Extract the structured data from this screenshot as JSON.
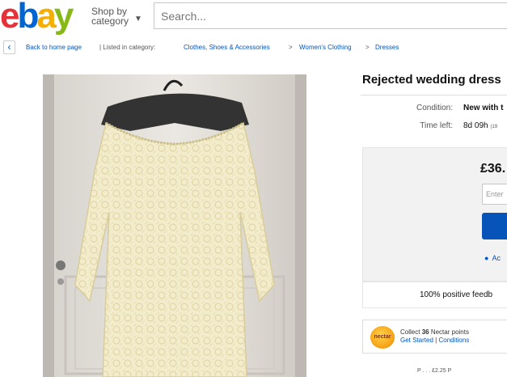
{
  "header": {
    "logo_text": "ebay",
    "shop_by_line1": "Shop by",
    "shop_by_line2": "category",
    "search_placeholder": "Search..."
  },
  "breadcrumb": {
    "back_label": "Back to home page",
    "listed_label": "| Listed in category:",
    "categories": [
      "Clothes, Shoes & Accessories",
      "Women's Clothing",
      "Dresses"
    ],
    "separator": ">"
  },
  "item": {
    "title": "Rejected wedding dress",
    "condition_label": "Condition:",
    "condition_value": "New with t",
    "time_left_label": "Time left:",
    "time_left_value": "8d 09h",
    "time_left_detail": "(19"
  },
  "bid": {
    "price": "£36.",
    "input_placeholder": "Enter",
    "watch_label": "Ac"
  },
  "seller": {
    "feedback": "100% positive feedb"
  },
  "nectar": {
    "logo_text": "nectar",
    "line1_prefix": "Collect",
    "points": "36",
    "line1_suffix": "Nectar points",
    "get_started": "Get Started",
    "divider": "|",
    "conditions": "Conditions"
  },
  "footer_fragment": "P . . . £2.25 P",
  "colors": {
    "link": "#0654ba",
    "logo_e": "#e53238",
    "logo_b": "#0064d2",
    "logo_a": "#f5af02",
    "logo_y": "#86b817"
  }
}
